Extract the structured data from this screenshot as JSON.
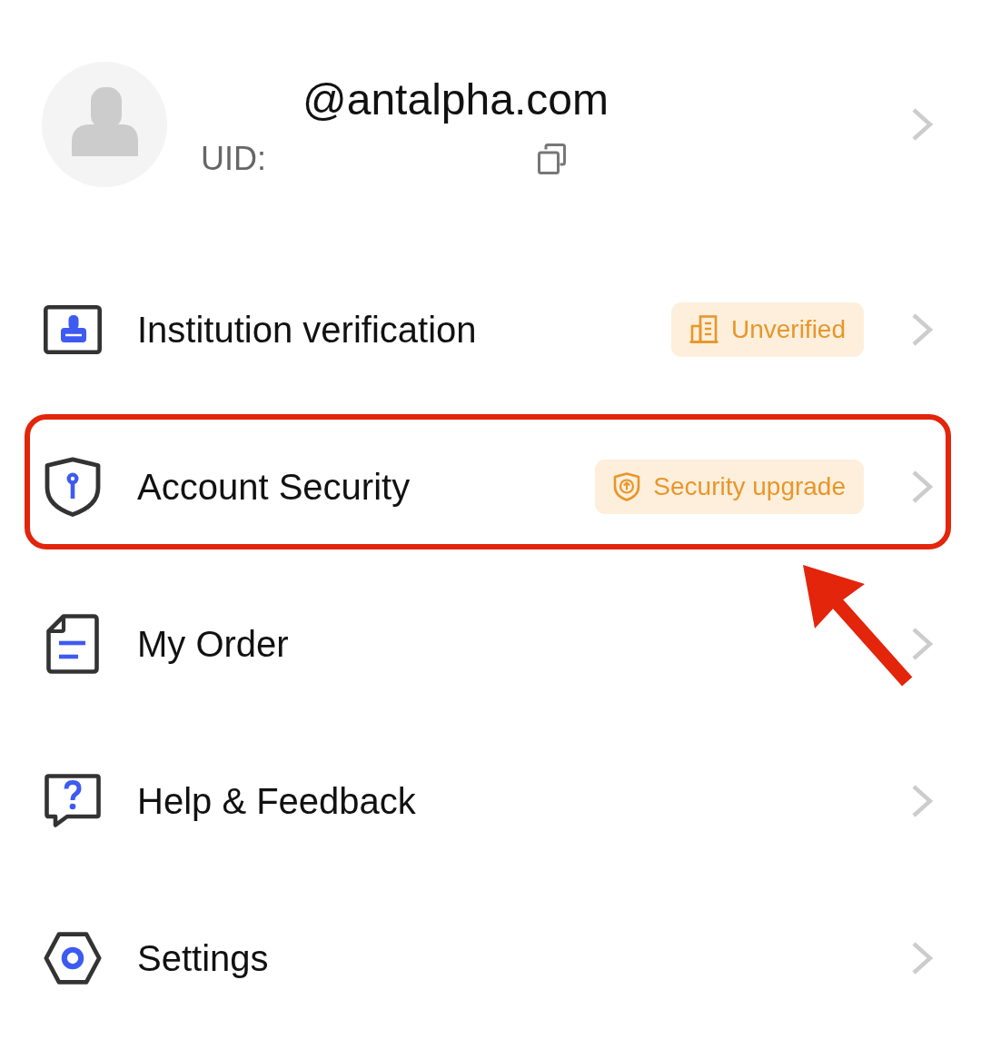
{
  "profile": {
    "email": "@antalpha.com",
    "uid_label": "UID:"
  },
  "menu": [
    {
      "kind": "institution",
      "label": "Institution verification",
      "badge": {
        "kind": "building",
        "text": "Unverified"
      },
      "highlighted": false
    },
    {
      "kind": "security",
      "label": "Account Security",
      "badge": {
        "kind": "shield",
        "text": "Security upgrade"
      },
      "highlighted": true
    },
    {
      "kind": "order",
      "label": "My Order",
      "highlighted": false
    },
    {
      "kind": "help",
      "label": "Help & Feedback",
      "highlighted": false
    },
    {
      "kind": "settings",
      "label": "Settings",
      "highlighted": false
    }
  ]
}
